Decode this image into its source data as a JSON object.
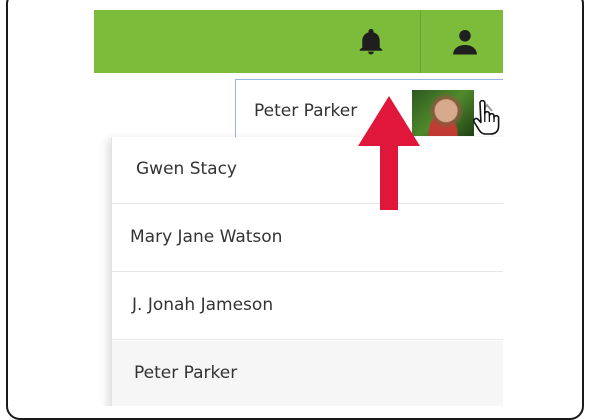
{
  "user_selector": {
    "label": "Peter Parker"
  },
  "dropdown": {
    "items": [
      {
        "label": "Gwen Stacy"
      },
      {
        "label": "Mary Jane Watson"
      },
      {
        "label": "J. Jonah Jameson"
      },
      {
        "label": "Peter Parker"
      }
    ],
    "selected_index": 3
  },
  "colors": {
    "topbar": "#7dbb3b",
    "icons": "#1f1f1f",
    "annotation_arrow": "#e0173a",
    "selector_border": "#9ab6e6"
  },
  "icons": {
    "topbar_left": "bell-icon",
    "topbar_right": "user-icon",
    "selector_caret": "chevron-up-icon",
    "cursor": "hand-pointer-icon"
  }
}
